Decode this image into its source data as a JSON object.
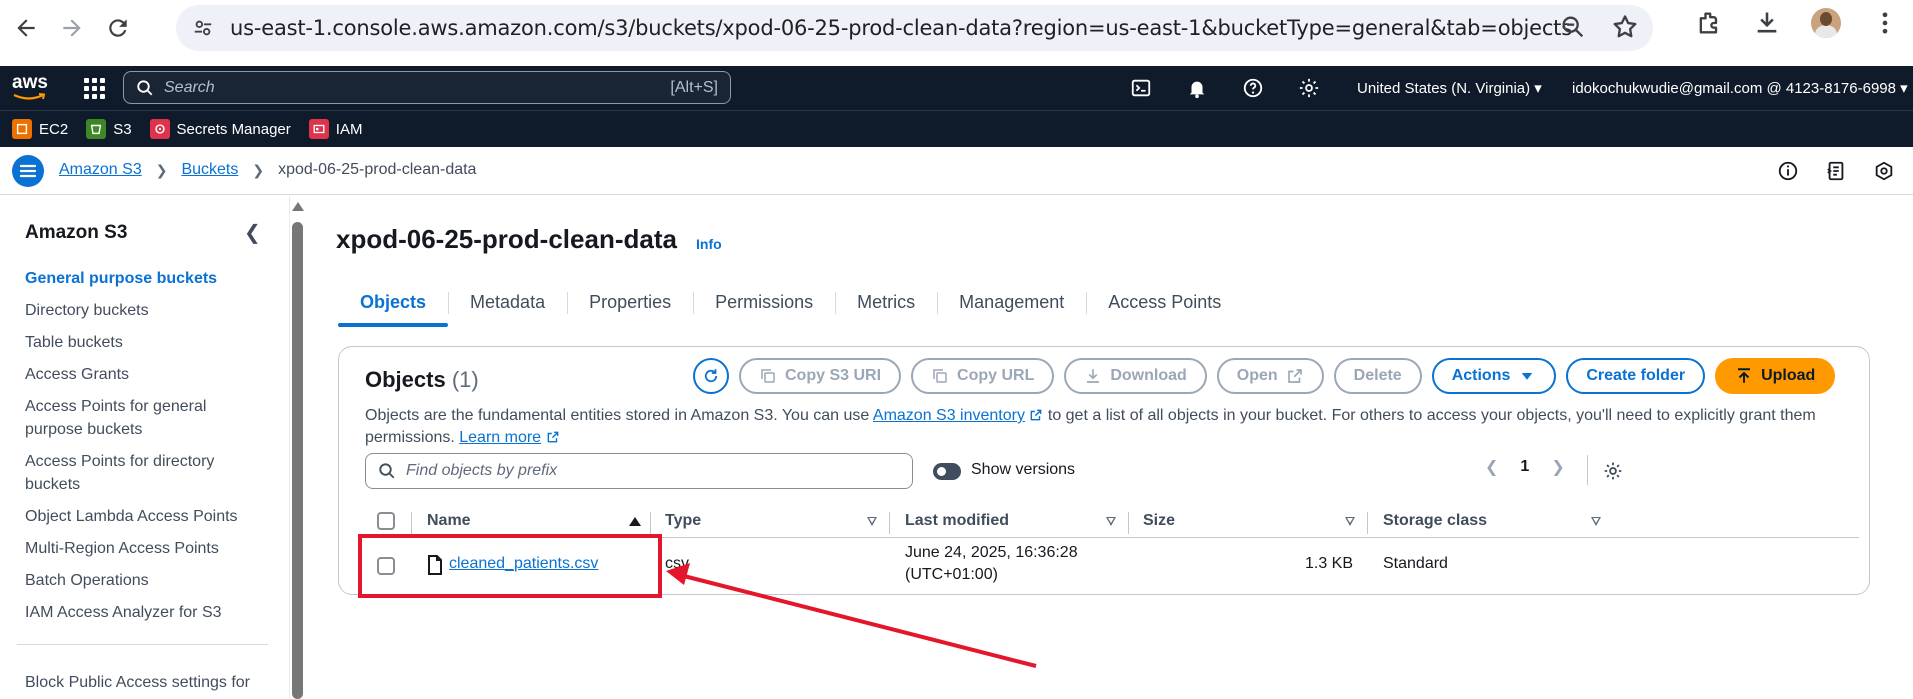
{
  "browser": {
    "url": "us-east-1.console.aws.amazon.com/s3/buckets/xpod-06-25-prod-clean-data?region=us-east-1&bucketType=general&tab=objects"
  },
  "awsnav": {
    "logo": "aws",
    "search_placeholder": "Search",
    "search_shortcut": "[Alt+S]",
    "region": "United States (N. Virginia) ▾",
    "account": "idokochukwudie@gmail.com @ 4123-8176-6998 ▾"
  },
  "favorites": [
    {
      "label": "EC2",
      "color": "#ed7100"
    },
    {
      "label": "S3",
      "color": "#3f8624"
    },
    {
      "label": "Secrets Manager",
      "color": "#dd344c"
    },
    {
      "label": "IAM",
      "color": "#dd344c"
    }
  ],
  "breadcrumb": {
    "items": [
      "Amazon S3",
      "Buckets"
    ],
    "current": "xpod-06-25-prod-clean-data"
  },
  "sidebar": {
    "title": "Amazon S3",
    "items": [
      "General purpose buckets",
      "Directory buckets",
      "Table buckets",
      "Access Grants",
      "Access Points for general purpose buckets",
      "Access Points for directory buckets",
      "Object Lambda Access Points",
      "Multi-Region Access Points",
      "Batch Operations",
      "IAM Access Analyzer for S3"
    ],
    "active_index": 0,
    "bottom_item": "Block Public Access settings for"
  },
  "main": {
    "bucket_name": "xpod-06-25-prod-clean-data",
    "info_label": "Info",
    "tabs": [
      "Objects",
      "Metadata",
      "Properties",
      "Permissions",
      "Metrics",
      "Management",
      "Access Points"
    ],
    "active_tab": 0
  },
  "objects_panel": {
    "title": "Objects",
    "count": "(1)",
    "buttons": {
      "copy_uri": "Copy S3 URI",
      "copy_url": "Copy URL",
      "download": "Download",
      "open": "Open",
      "delete": "Delete",
      "actions": "Actions",
      "create_folder": "Create folder",
      "upload": "Upload"
    },
    "description_1": "Objects are the fundamental entities stored in Amazon S3. You can use ",
    "inventory_link": "Amazon S3 inventory",
    "description_2": " to get a list of all objects in your bucket. For others to access your objects, you'll need to explicitly grant them permissions. ",
    "learn_more": "Learn more",
    "filter_placeholder": "Find objects by prefix",
    "show_versions": "Show versions",
    "page": "1",
    "columns": [
      "Name",
      "Type",
      "Last modified",
      "Size",
      "Storage class"
    ],
    "rows": [
      {
        "name": "cleaned_patients.csv",
        "type": "csv",
        "modified_1": "June 24, 2025, 16:36:28",
        "modified_2": "(UTC+01:00)",
        "size": "1.3 KB",
        "storage_class": "Standard"
      }
    ]
  },
  "annotation": {
    "highlight_color": "#e3162b"
  }
}
